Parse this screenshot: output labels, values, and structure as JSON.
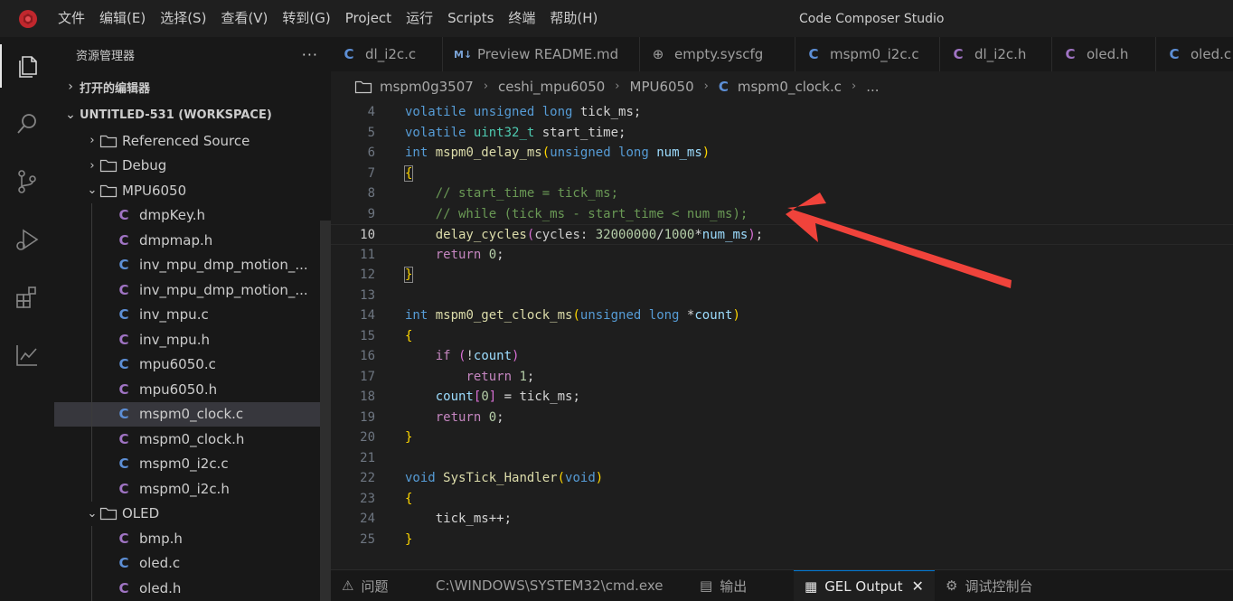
{
  "titlebar": {
    "menu": [
      "文件",
      "编辑(E)",
      "选择(S)",
      "查看(V)",
      "转到(G)",
      "Project",
      "运行",
      "Scripts",
      "终端",
      "帮助(H)"
    ],
    "window_title": "Code Composer Studio"
  },
  "activitybar": {
    "items": [
      "explorer-icon",
      "search-icon",
      "source-control-icon",
      "run-debug-icon",
      "extensions-icon",
      "chart-icon"
    ]
  },
  "sidebar": {
    "title": "资源管理器",
    "more": "···",
    "open_editors": "打开的编辑器",
    "workspace": "UNTITLED-531 (WORKSPACE)",
    "tree": [
      {
        "label": "Referenced Source",
        "kind": "folder",
        "depth": 1,
        "expanded": false
      },
      {
        "label": "Debug",
        "kind": "folder",
        "depth": 1,
        "expanded": false
      },
      {
        "label": "MPU6050",
        "kind": "folder",
        "depth": 1,
        "expanded": true
      },
      {
        "label": "dmpKey.h",
        "kind": "h",
        "depth": 2
      },
      {
        "label": "dmpmap.h",
        "kind": "h",
        "depth": 2
      },
      {
        "label": "inv_mpu_dmp_motion_...",
        "kind": "c",
        "depth": 2
      },
      {
        "label": "inv_mpu_dmp_motion_...",
        "kind": "h",
        "depth": 2
      },
      {
        "label": "inv_mpu.c",
        "kind": "c",
        "depth": 2
      },
      {
        "label": "inv_mpu.h",
        "kind": "h",
        "depth": 2
      },
      {
        "label": "mpu6050.c",
        "kind": "c",
        "depth": 2
      },
      {
        "label": "mpu6050.h",
        "kind": "h",
        "depth": 2
      },
      {
        "label": "mspm0_clock.c",
        "kind": "c",
        "depth": 2,
        "selected": true
      },
      {
        "label": "mspm0_clock.h",
        "kind": "h",
        "depth": 2
      },
      {
        "label": "mspm0_i2c.c",
        "kind": "c",
        "depth": 2
      },
      {
        "label": "mspm0_i2c.h",
        "kind": "h",
        "depth": 2
      },
      {
        "label": "OLED",
        "kind": "folder",
        "depth": 1,
        "expanded": true
      },
      {
        "label": "bmp.h",
        "kind": "h",
        "depth": 2
      },
      {
        "label": "oled.c",
        "kind": "c",
        "depth": 2
      },
      {
        "label": "oled.h",
        "kind": "h",
        "depth": 2
      }
    ]
  },
  "tabs": [
    {
      "label": "dl_i2c.c",
      "icon": "C",
      "kind": "c",
      "width": 124
    },
    {
      "label": "Preview README.md",
      "icon": "M↓",
      "kind": "md",
      "width": 218
    },
    {
      "label": "empty.syscfg",
      "icon": "⊕",
      "kind": "globe",
      "width": 172
    },
    {
      "label": "mspm0_i2c.c",
      "icon": "C",
      "kind": "c",
      "width": 160
    },
    {
      "label": "dl_i2c.h",
      "icon": "C",
      "kind": "h",
      "width": 124
    },
    {
      "label": "oled.h",
      "icon": "C",
      "kind": "h",
      "width": 115
    },
    {
      "label": "oled.c",
      "icon": "C",
      "kind": "c",
      "width": 100
    }
  ],
  "breadcrumb": [
    "mspm0g3507",
    "ceshi_mpu6050",
    "MPU6050",
    "mspm0_clock.c",
    "..."
  ],
  "code": {
    "current_line": 10,
    "lines": [
      {
        "n": "4",
        "tokens": [
          [
            "kw",
            "volatile"
          ],
          [
            "pl",
            " "
          ],
          [
            "kw",
            "unsigned"
          ],
          [
            "pl",
            " "
          ],
          [
            "kw",
            "long"
          ],
          [
            "pl",
            " tick_ms;"
          ]
        ]
      },
      {
        "n": "5",
        "tokens": [
          [
            "kw",
            "volatile"
          ],
          [
            "pl",
            " "
          ],
          [
            "ty",
            "uint32_t"
          ],
          [
            "pl",
            " start_time;"
          ]
        ]
      },
      {
        "n": "6",
        "tokens": [
          [
            "kw",
            "int"
          ],
          [
            "pl",
            " "
          ],
          [
            "fn",
            "mspm0_delay_ms"
          ],
          [
            "br",
            "("
          ],
          [
            "kw",
            "unsigned"
          ],
          [
            "pl",
            " "
          ],
          [
            "kw",
            "long"
          ],
          [
            "pl",
            " "
          ],
          [
            "pa",
            "num_ms"
          ],
          [
            "br",
            ")"
          ]
        ]
      },
      {
        "n": "7",
        "tokens": [
          [
            "brbox",
            "{"
          ]
        ]
      },
      {
        "n": "8",
        "tokens": [
          [
            "pl",
            "    "
          ],
          [
            "cm",
            "// start_time = tick_ms;"
          ]
        ]
      },
      {
        "n": "9",
        "tokens": [
          [
            "pl",
            "    "
          ],
          [
            "cm",
            "// while (tick_ms - start_time < num_ms);"
          ]
        ]
      },
      {
        "n": "10",
        "tokens": [
          [
            "pl",
            "    "
          ],
          [
            "fn",
            "delay_cycles"
          ],
          [
            "br2",
            "("
          ],
          [
            "hint",
            "cycles: "
          ],
          [
            "nu",
            "32000000"
          ],
          [
            "pl",
            "/"
          ],
          [
            "nu",
            "1000"
          ],
          [
            "pl",
            "*"
          ],
          [
            "pa",
            "num_ms"
          ],
          [
            "br2",
            ")"
          ],
          [
            "pl",
            ";"
          ]
        ]
      },
      {
        "n": "11",
        "tokens": [
          [
            "pl",
            "    "
          ],
          [
            "ct",
            "return"
          ],
          [
            "pl",
            " "
          ],
          [
            "nu",
            "0"
          ],
          [
            "pl",
            ";"
          ]
        ]
      },
      {
        "n": "12",
        "tokens": [
          [
            "brbox",
            "}"
          ]
        ]
      },
      {
        "n": "13",
        "tokens": []
      },
      {
        "n": "14",
        "tokens": [
          [
            "kw",
            "int"
          ],
          [
            "pl",
            " "
          ],
          [
            "fn",
            "mspm0_get_clock_ms"
          ],
          [
            "br",
            "("
          ],
          [
            "kw",
            "unsigned"
          ],
          [
            "pl",
            " "
          ],
          [
            "kw",
            "long"
          ],
          [
            "pl",
            " *"
          ],
          [
            "pa",
            "count"
          ],
          [
            "br",
            ")"
          ]
        ]
      },
      {
        "n": "15",
        "tokens": [
          [
            "br",
            "{"
          ]
        ]
      },
      {
        "n": "16",
        "tokens": [
          [
            "pl",
            "    "
          ],
          [
            "ct",
            "if"
          ],
          [
            "pl",
            " "
          ],
          [
            "br2",
            "("
          ],
          [
            "pl",
            "!"
          ],
          [
            "pa",
            "count"
          ],
          [
            "br2",
            ")"
          ]
        ]
      },
      {
        "n": "17",
        "tokens": [
          [
            "pl",
            "        "
          ],
          [
            "ct",
            "return"
          ],
          [
            "pl",
            " "
          ],
          [
            "nu",
            "1"
          ],
          [
            "pl",
            ";"
          ]
        ]
      },
      {
        "n": "18",
        "tokens": [
          [
            "pl",
            "    "
          ],
          [
            "pa",
            "count"
          ],
          [
            "br2",
            "["
          ],
          [
            "nu",
            "0"
          ],
          [
            "br2",
            "]"
          ],
          [
            "pl",
            " = tick_ms;"
          ]
        ]
      },
      {
        "n": "19",
        "tokens": [
          [
            "pl",
            "    "
          ],
          [
            "ct",
            "return"
          ],
          [
            "pl",
            " "
          ],
          [
            "nu",
            "0"
          ],
          [
            "pl",
            ";"
          ]
        ]
      },
      {
        "n": "20",
        "tokens": [
          [
            "br",
            "}"
          ]
        ]
      },
      {
        "n": "21",
        "tokens": []
      },
      {
        "n": "22",
        "tokens": [
          [
            "kw",
            "void"
          ],
          [
            "pl",
            " "
          ],
          [
            "fn",
            "SysTick_Handler"
          ],
          [
            "br",
            "("
          ],
          [
            "kw",
            "void"
          ],
          [
            "br",
            ")"
          ]
        ]
      },
      {
        "n": "23",
        "tokens": [
          [
            "br",
            "{"
          ]
        ]
      },
      {
        "n": "24",
        "tokens": [
          [
            "pl",
            "    tick_ms++;"
          ]
        ]
      },
      {
        "n": "25",
        "tokens": [
          [
            "br",
            "}"
          ]
        ]
      }
    ]
  },
  "panel": {
    "tabs": [
      {
        "label": "问题",
        "icon": "⚠",
        "active": false
      },
      {
        "label": "C:\\WINDOWS\\SYSTEM32\\cmd.exe",
        "icon": "",
        "active": false
      },
      {
        "label": "输出",
        "icon": "▤",
        "active": false
      },
      {
        "label": "GEL Output",
        "icon": "▦",
        "active": true
      },
      {
        "label": "调试控制台",
        "icon": "⚙",
        "active": false
      }
    ]
  },
  "annotation": {
    "color": "#f0433b"
  }
}
